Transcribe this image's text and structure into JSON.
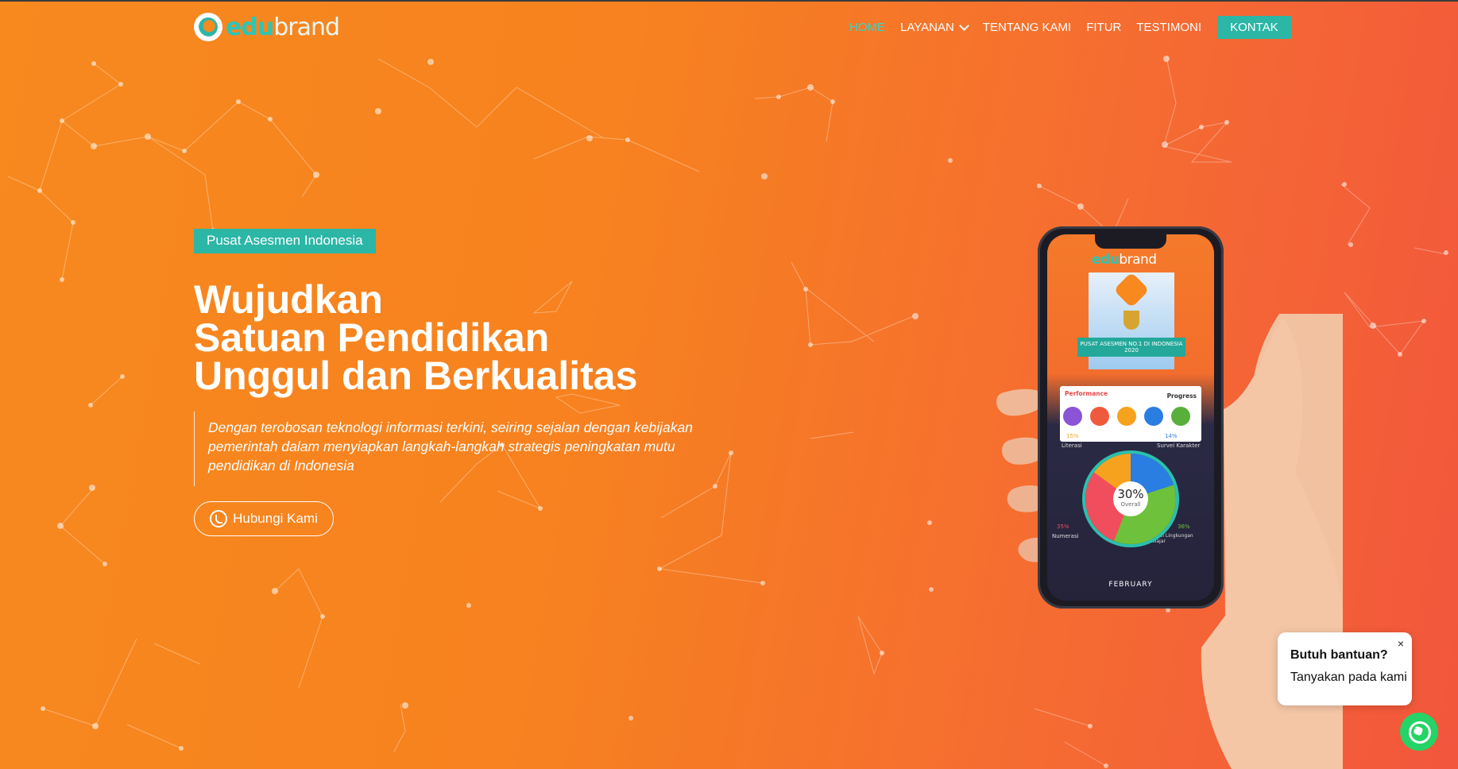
{
  "brand": {
    "logo_edu": "edu",
    "logo_brand": "brand",
    "accent_color": "#2bb6a6",
    "background_from": "#f7891f",
    "background_to": "#f2563c"
  },
  "nav": {
    "items": [
      {
        "label": "HOME",
        "active": true
      },
      {
        "label": "LAYANAN",
        "dropdown": true
      },
      {
        "label": "TENTANG KAMI"
      },
      {
        "label": "FITUR"
      },
      {
        "label": "TESTIMONI"
      }
    ],
    "cta_label": "KONTAK"
  },
  "hero": {
    "badge": "Pusat Asesmen Indonesia",
    "title_lines": [
      "Wujudkan",
      "Satuan Pendidikan",
      "Unggul dan Berkualitas"
    ],
    "description": "Dengan terobosan teknologi informasi terkini, seiring sejalan dengan kebijakan pemerintah dalam menyiapkan langkah-langkah strategis peningkatan mutu pendidikan di Indonesia",
    "button_label": "Hubungi Kami",
    "button_icon": "whatsapp-icon"
  },
  "phone": {
    "logo_edu": "edu",
    "logo_brand": "brand",
    "award_text": "PUSAT ASESMEN NO.1 DI INDONESIA",
    "award_year": "2020",
    "performance_label": "Performance",
    "progress_label": "Progress",
    "chart_center_value": "30%",
    "chart_center_label": "Overall",
    "segments": [
      {
        "label": "Literasi",
        "value": "15%"
      },
      {
        "label": "Survei Karakter",
        "value": "14%"
      },
      {
        "label": "Numerasi",
        "value": "35%"
      },
      {
        "label": "Survei Lingkungan Belajar",
        "value": "36%"
      }
    ],
    "month": "FEBRUARY"
  },
  "chat_popup": {
    "close_symbol": "×",
    "question": "Butuh bantuan?",
    "prompt": "Tanyakan pada kami"
  },
  "whatsapp_button": {
    "icon": "whatsapp-icon",
    "color": "#25d366"
  }
}
